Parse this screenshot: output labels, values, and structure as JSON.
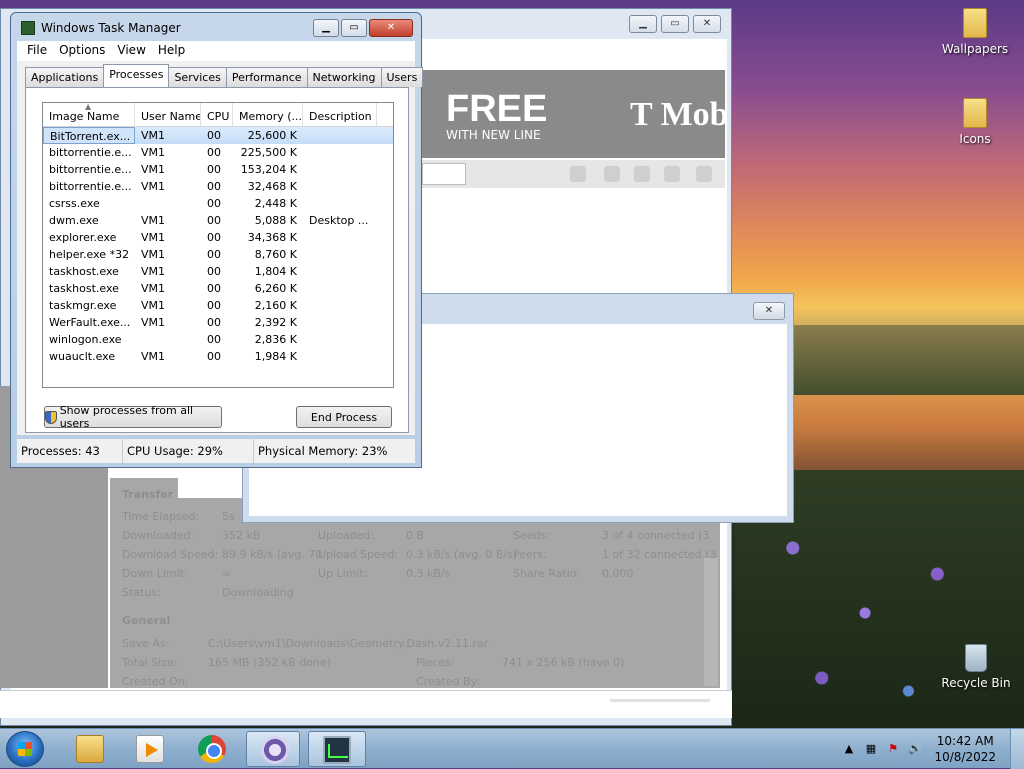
{
  "desktop": {
    "icons": [
      {
        "label": "Wallpapers"
      },
      {
        "label": "Icons"
      },
      {
        "label": "Recycle Bin"
      }
    ]
  },
  "browser": {
    "ad": {
      "headline": "FREE",
      "subline": "WITH NEW LINE",
      "brand": "T Mob"
    }
  },
  "transfer": {
    "section_title": "Transfer",
    "general_title": "General",
    "rows": [
      {
        "label": "Time Elapsed:",
        "value": "5s"
      },
      {
        "label": "Downloaded:",
        "value": "352 kB",
        "label2": "Uploaded:",
        "value2": "0 B",
        "label3": "Seeds:",
        "value3": "3 of 4 connected (3"
      },
      {
        "label": "Download Speed:",
        "value": "89.9 kB/s (avg. 70.",
        "label2": "Upload Speed:",
        "value2": "0.3 kB/s (avg. 0 B/s)",
        "label3": "Peers:",
        "value3": "1 of 32 connected (3"
      },
      {
        "label": "Down Limit:",
        "value": "∞",
        "label2": "Up Limit:",
        "value2": "0.3 kB/s",
        "label3": "Share Ratio:",
        "value3": "0.000"
      },
      {
        "label": "Status:",
        "value": "Downloading"
      }
    ],
    "general": [
      {
        "label": "Save As:",
        "value": "C:\\Users\\vm1\\Downloads\\Geometry.Dash.v2.11.rar"
      },
      {
        "label": "Total Size:",
        "value": "165 MB (352 kB done)",
        "label2": "Pieces:",
        "value2": "741 x 256 kB (have 0)"
      },
      {
        "label": "Created On:",
        "value": "",
        "label2": "Created By:",
        "value2": ""
      }
    ]
  },
  "taskmgr": {
    "title": "Windows Task Manager",
    "menu": [
      "File",
      "Options",
      "View",
      "Help"
    ],
    "tabs": [
      "Applications",
      "Processes",
      "Services",
      "Performance",
      "Networking",
      "Users"
    ],
    "active_tab": 1,
    "columns": [
      "Image Name",
      "User Name",
      "CPU",
      "Memory (...",
      "Description"
    ],
    "processes": [
      {
        "name": "BitTorrent.ex...",
        "user": "VM1",
        "cpu": "00",
        "mem": "25,600 K",
        "desc": ""
      },
      {
        "name": "bittorrentie.e...",
        "user": "VM1",
        "cpu": "00",
        "mem": "225,500 K",
        "desc": ""
      },
      {
        "name": "bittorrentie.e...",
        "user": "VM1",
        "cpu": "00",
        "mem": "153,204 K",
        "desc": ""
      },
      {
        "name": "bittorrentie.e...",
        "user": "VM1",
        "cpu": "00",
        "mem": "32,468 K",
        "desc": ""
      },
      {
        "name": "csrss.exe",
        "user": "",
        "cpu": "00",
        "mem": "2,448 K",
        "desc": ""
      },
      {
        "name": "dwm.exe",
        "user": "VM1",
        "cpu": "00",
        "mem": "5,088 K",
        "desc": "Desktop ..."
      },
      {
        "name": "explorer.exe",
        "user": "VM1",
        "cpu": "00",
        "mem": "34,368 K",
        "desc": ""
      },
      {
        "name": "helper.exe *32",
        "user": "VM1",
        "cpu": "00",
        "mem": "8,760 K",
        "desc": ""
      },
      {
        "name": "taskhost.exe",
        "user": "VM1",
        "cpu": "00",
        "mem": "1,804 K",
        "desc": ""
      },
      {
        "name": "taskhost.exe",
        "user": "VM1",
        "cpu": "00",
        "mem": "6,260 K",
        "desc": ""
      },
      {
        "name": "taskmgr.exe",
        "user": "VM1",
        "cpu": "00",
        "mem": "2,160 K",
        "desc": ""
      },
      {
        "name": "WerFault.exe...",
        "user": "VM1",
        "cpu": "00",
        "mem": "2,392 K",
        "desc": ""
      },
      {
        "name": "winlogon.exe",
        "user": "",
        "cpu": "00",
        "mem": "2,836 K",
        "desc": ""
      },
      {
        "name": "wuauclt.exe",
        "user": "VM1",
        "cpu": "00",
        "mem": "1,984 K",
        "desc": ""
      }
    ],
    "show_all_label": "Show processes from all users",
    "end_process_label": "End Process",
    "status": {
      "processes": "Processes: 43",
      "cpu": "CPU Usage: 29%",
      "memory": "Physical Memory: 23%"
    }
  },
  "taskbar": {
    "pinned": [
      "windows-explorer",
      "media-player",
      "chrome",
      "bittorrent",
      "task-manager"
    ],
    "clock_time": "10:42 AM",
    "clock_date": "10/8/2022"
  }
}
